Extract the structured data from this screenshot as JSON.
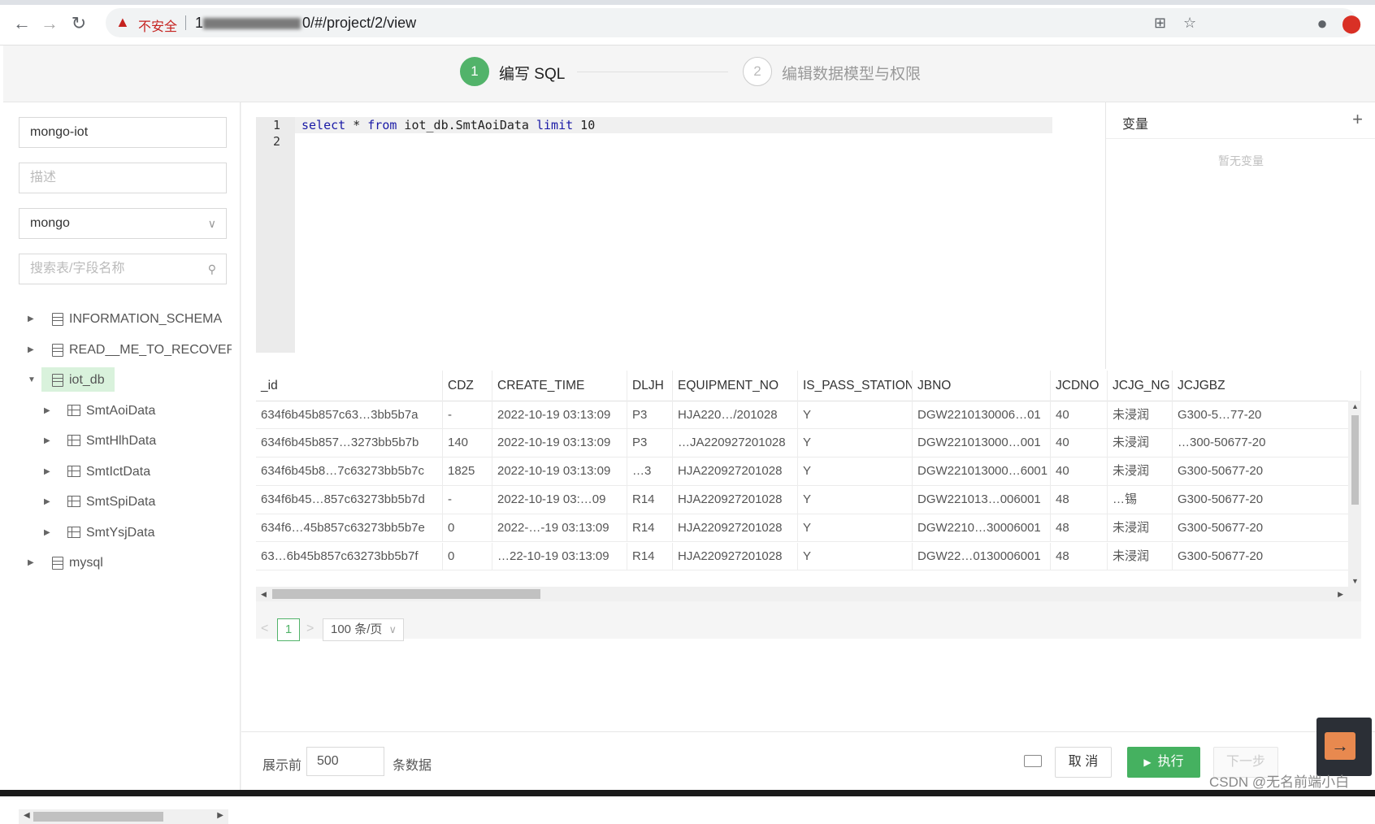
{
  "browser": {
    "security_label": "不安全",
    "url_visible": "0/#/project/2/view",
    "url_prefix": "1"
  },
  "steps": [
    {
      "number": "1",
      "label": "编写 SQL"
    },
    {
      "number": "2",
      "label": "编辑数据模型与权限"
    }
  ],
  "sidebar": {
    "connection_name": "mongo-iot",
    "description_placeholder": "描述",
    "db_type": "mongo",
    "search_placeholder": "搜索表/字段名称",
    "tree": [
      {
        "label": "INFORMATION_SCHEMA",
        "type": "db"
      },
      {
        "label": "READ__ME_TO_RECOVER_Y",
        "type": "db"
      },
      {
        "label": "iot_db",
        "type": "db",
        "expanded": true,
        "selected": true
      },
      {
        "label": "SmtAoiData",
        "type": "table"
      },
      {
        "label": "SmtHlhData",
        "type": "table"
      },
      {
        "label": "SmtIctData",
        "type": "table"
      },
      {
        "label": "SmtSpiData",
        "type": "table"
      },
      {
        "label": "SmtYsjData",
        "type": "table"
      },
      {
        "label": "mysql",
        "type": "db"
      }
    ]
  },
  "editor": {
    "line_numbers": [
      "1",
      "2"
    ],
    "kw_select": "select",
    "star": " * ",
    "kw_from": "from",
    "table_ref": " iot_db.SmtAoiData ",
    "kw_limit": "limit",
    "limit_value": " 10"
  },
  "variables": {
    "title": "变量",
    "add": "+",
    "empty_text": "暂无变量"
  },
  "results": {
    "columns": [
      "_id",
      "CDZ",
      "CREATE_TIME",
      "DLJH",
      "EQUIPMENT_NO",
      "IS_PASS_STATION",
      "JBNO",
      "JCDNO",
      "JCJG_NG",
      "JCJGBZ"
    ],
    "rows": [
      [
        "634f6b45b857c63…3bb5b7a",
        "-",
        "2022-10-19 03:13:09",
        "P3",
        "HJA220…/201028",
        "Y",
        "DGW2210130006…01",
        "40",
        "未浸润",
        "G300-5…77-20"
      ],
      [
        "634f6b45b857…3273bb5b7b",
        "140",
        "2022-10-19 03:13:09",
        "P3",
        "…JA220927201028",
        "Y",
        "DGW221013000…001",
        "40",
        "未浸润",
        "…300-50677-20"
      ],
      [
        "634f6b45b8…7c63273bb5b7c",
        "1825",
        "2022-10-19 03:13:09",
        "…3",
        "HJA220927201028",
        "Y",
        "DGW221013000…6001",
        "40",
        "未浸润",
        "G300-50677-20"
      ],
      [
        "634f6b45…857c63273bb5b7d",
        "-",
        "2022-10-19 03:…09",
        "R14",
        "HJA220927201028",
        "Y",
        "DGW221013…006001",
        "48",
        "…锡",
        "G300-50677-20"
      ],
      [
        "634f6…45b857c63273bb5b7e",
        "0",
        "2022-…-19 03:13:09",
        "R14",
        "HJA220927201028",
        "Y",
        "DGW2210…30006001",
        "48",
        "未浸润",
        "G300-50677-20"
      ],
      [
        "63…6b45b857c63273bb5b7f",
        "0",
        "…22-10-19 03:13:09",
        "R14",
        "HJA220927201028",
        "Y",
        "DGW22…0130006001",
        "48",
        "未浸润",
        "G300-50677-20"
      ]
    ],
    "page_prev": "<",
    "page_current": "1",
    "page_next": ">",
    "page_size": "100 条/页"
  },
  "footer": {
    "show_prefix": "展示前",
    "row_limit": "500",
    "show_suffix": "条数据",
    "cancel": "取 消",
    "run": "执行",
    "next": "下一步"
  },
  "watermark": "CSDN @无名前端小白",
  "colors": {
    "accent": "#52b36a",
    "run_button": "#45b160",
    "selected_bg": "#d9f2dc"
  }
}
